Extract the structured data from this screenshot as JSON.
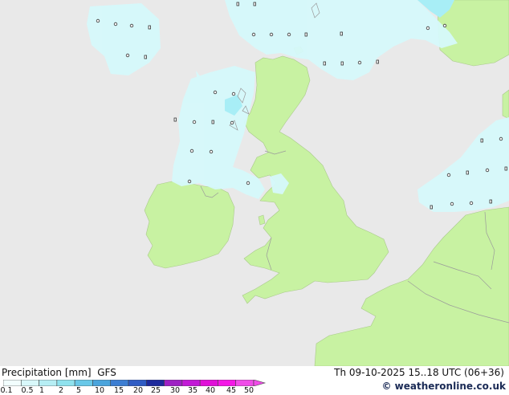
{
  "legend": {
    "title": "Precipitation [mm]",
    "model": "GFS",
    "ticks": [
      "0.1",
      "0.5",
      "1",
      "2",
      "5",
      "10",
      "15",
      "20",
      "25",
      "30",
      "35",
      "40",
      "45",
      "50"
    ],
    "colors": [
      "#f2fefe",
      "#d8f8fa",
      "#b6eef4",
      "#8fe2ee",
      "#68c8e8",
      "#4aa4dc",
      "#3d7ed2",
      "#2f5cc4",
      "#1e2a9c",
      "#9e22c4",
      "#c21ad6",
      "#e010d8",
      "#f418e6",
      "#f04ce8"
    ]
  },
  "timestamp": "Th 09-10-2025 15..18 UTC (06+36)",
  "credit": "© weatheronline.co.uk",
  "map_colors": {
    "sea": "#e9e9e9",
    "land": "#c8f2a2",
    "rain_light": "#d6f9fb",
    "rain_medium": "#a8eef6",
    "border": "#9a9a9a"
  },
  "icons": {
    "rain_marker": "raindrop-marker"
  }
}
